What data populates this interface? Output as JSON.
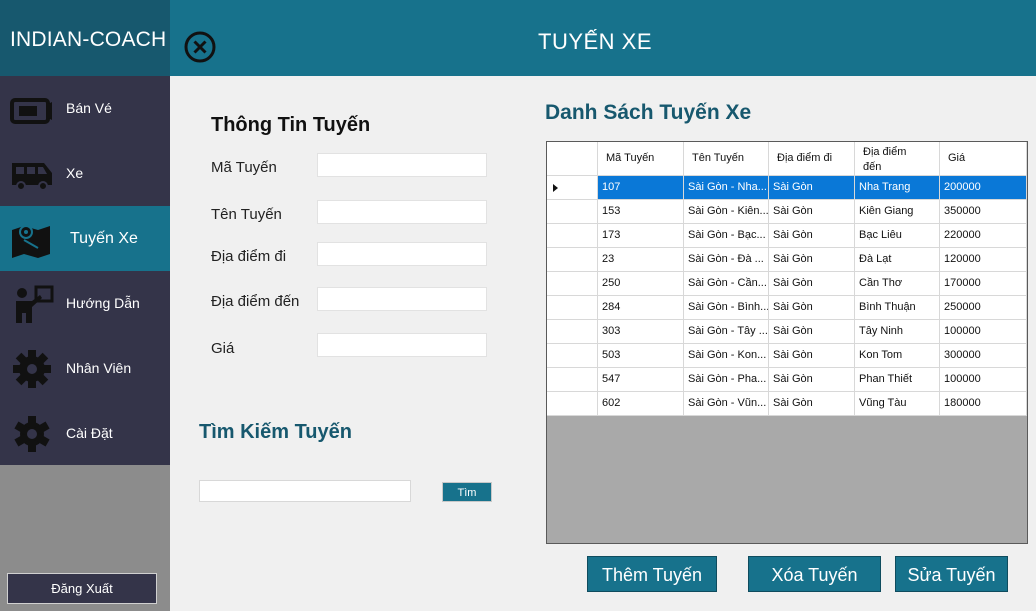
{
  "app": {
    "brand": "INDIAN-COACH",
    "page_title": "TUYẾN XE"
  },
  "sidebar": {
    "items": [
      {
        "label": "Bán Vé",
        "icon": "ticket-icon"
      },
      {
        "label": "Xe",
        "icon": "bus-icon"
      },
      {
        "label": "Tuyến Xe",
        "icon": "route-map-icon",
        "active": true
      },
      {
        "label": "Hướng Dẫn",
        "icon": "guide-icon"
      },
      {
        "label": "Nhân Viên",
        "icon": "gear-icon"
      },
      {
        "label": "Cài Đặt",
        "icon": "settings-gear-icon"
      }
    ],
    "logout_label": "Đăng Xuất"
  },
  "form": {
    "title": "Thông Tin Tuyến",
    "fields": [
      {
        "label": "Mã Tuyến",
        "value": ""
      },
      {
        "label": "Tên Tuyến",
        "value": ""
      },
      {
        "label": "Địa điểm đi",
        "value": ""
      },
      {
        "label": "Địa điểm đến",
        "value": ""
      },
      {
        "label": "Giá",
        "value": ""
      }
    ]
  },
  "search": {
    "title": "Tìm Kiếm Tuyến",
    "value": "",
    "button_label": "Tìm"
  },
  "grid": {
    "title": "Danh Sách Tuyến Xe",
    "columns": [
      "Mã Tuyến",
      "Tên Tuyến",
      "Địa điểm đi",
      "Địa điểm đến",
      "Giá"
    ],
    "rows": [
      [
        "107",
        "Sài Gòn - Nha...",
        "Sài Gòn",
        "Nha Trang",
        "200000"
      ],
      [
        "153",
        "Sài Gòn - Kiên...",
        "Sài Gòn",
        "Kiên Giang",
        "350000"
      ],
      [
        "173",
        "Sài Gòn - Bạc...",
        "Sài Gòn",
        "Bạc Liêu",
        "220000"
      ],
      [
        "23",
        "Sài Gòn - Đà ...",
        "Sài Gòn",
        "Đà Lạt",
        "120000"
      ],
      [
        "250",
        "Sài Gòn - Cần...",
        "Sài Gòn",
        "Cần Thơ",
        "170000"
      ],
      [
        "284",
        "Sài Gòn - Bình...",
        "Sài Gòn",
        "Bình Thuận",
        "250000"
      ],
      [
        "303",
        "Sài Gòn - Tây ...",
        "Sài Gòn",
        "Tây Ninh",
        "100000"
      ],
      [
        "503",
        "Sài Gòn - Kon...",
        "Sài Gòn",
        "Kon Tom",
        "300000"
      ],
      [
        "547",
        "Sài Gòn - Pha...",
        "Sài Gòn",
        "Phan Thiết",
        "100000"
      ],
      [
        "602",
        "Sài Gòn - Vũn...",
        "Sài Gòn",
        "Vũng Tàu",
        "180000"
      ]
    ],
    "selected_row": 0
  },
  "actions": {
    "add_label": "Thêm Tuyến",
    "delete_label": "Xóa Tuyến",
    "edit_label": "Sửa Tuyến"
  },
  "colors": {
    "header": "#17728c",
    "brand_bg": "#17586e",
    "sidebar": "#343449",
    "selection": "#0a78d7"
  }
}
